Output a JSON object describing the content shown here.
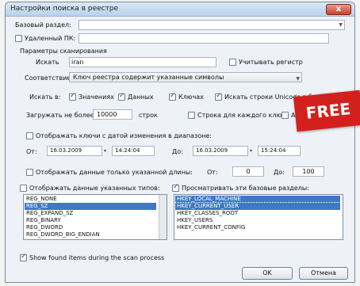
{
  "window": {
    "title": "Настройки поиска в реестре",
    "close": "x"
  },
  "base_section": {
    "label": "Базовый раздел:",
    "value": ""
  },
  "remote_pc": {
    "label": "Удаленный ПК:",
    "checked": false,
    "value": ""
  },
  "scan_params_label": "Параметры сканирования",
  "search": {
    "label": "Искать",
    "value": "iran",
    "case_sensitive": {
      "label": "Учитывать регистр",
      "checked": false
    }
  },
  "match": {
    "label": "Соответствие:",
    "value": "Ключ реестра содержит указанные символы"
  },
  "search_in": {
    "label": "Искать в:",
    "values": {
      "label": "Значениях",
      "checked": true
    },
    "data": {
      "label": "Данных",
      "checked": true
    },
    "keys": {
      "label": "Ключах",
      "checked": true
    },
    "unicode": {
      "label": "Искать строки Unicode в би",
      "checked": true
    }
  },
  "load_limit": {
    "label": "Загружать не более",
    "value": "10000",
    "unit": "строк",
    "one_per_key": {
      "label": "Строка для каждого ключа",
      "checked": false
    },
    "add": {
      "label": "Add",
      "checked": false
    }
  },
  "date_filter": {
    "label": "Отображать ключи с датой изменения в диапазоне:",
    "checked": false,
    "from_label": "От:",
    "from_date": "16.03.2009",
    "from_time": "14:24:04",
    "to_label": "До:",
    "to_date": "16.03.2009",
    "to_time": "15:24:04"
  },
  "length_filter": {
    "label": "Отображать данные только указанной длины:",
    "checked": false,
    "from_label": "От:",
    "from_value": "0",
    "to_label": "До:",
    "to_value": "100"
  },
  "types": {
    "label": "Отображать данные указанных типов:",
    "checked": false,
    "items": [
      "REG_NONE",
      "REG_SZ",
      "REG_EXPAND_SZ",
      "REG_BINARY",
      "REG_DWORD",
      "REG_DWORD_BIG_ENDIAN"
    ],
    "selected_index": 1
  },
  "sections": {
    "label": "Просматривать эти базовые разделы:",
    "checked": true,
    "items": [
      "HKEY_LOCAL_MACHINE",
      "HKEY_CURRENT_USER",
      "HKEY_CLASSES_ROOT",
      "HKEY_USERS",
      "HKEY_CURRENT_CONFIG"
    ],
    "selected_indices": [
      0,
      1
    ]
  },
  "show_found": {
    "label": "Show found items during the scan process",
    "checked": true
  },
  "buttons": {
    "ok": "OK",
    "cancel": "Отмена"
  },
  "badge": {
    "text": "FREE",
    "color": "#d3201c"
  }
}
